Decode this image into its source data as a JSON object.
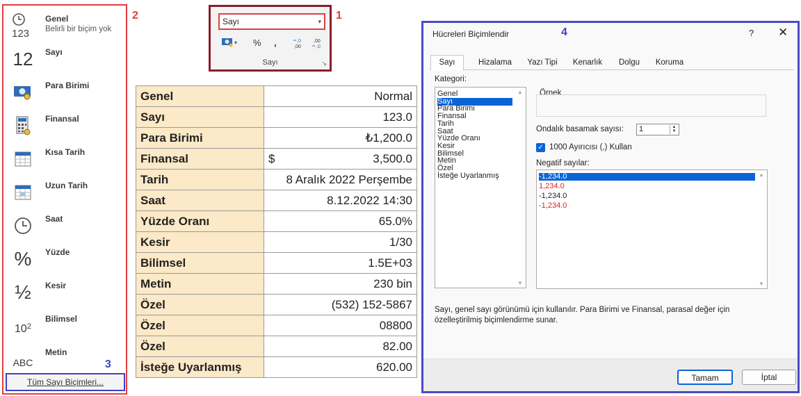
{
  "gallery": {
    "items": [
      {
        "icon": "clock-123-icon",
        "label": "Genel",
        "sub": "Belirli bir biçim yok"
      },
      {
        "icon": "number-12-icon",
        "label": "Sayı"
      },
      {
        "icon": "money-icon",
        "label": "Para Birimi"
      },
      {
        "icon": "calculator-icon",
        "label": "Finansal"
      },
      {
        "icon": "calendar-short-icon",
        "label": "Kısa Tarih"
      },
      {
        "icon": "calendar-long-icon",
        "label": "Uzun Tarih"
      },
      {
        "icon": "clock-icon",
        "label": "Saat"
      },
      {
        "icon": "percent-icon",
        "label": "Yüzde"
      },
      {
        "icon": "fraction-icon",
        "label": "Kesir"
      },
      {
        "icon": "scientific-icon",
        "label": "Bilimsel"
      },
      {
        "icon": "abc-icon",
        "label": "Metin"
      }
    ],
    "icon_glyphs": {
      "number12": "12",
      "percent": "%",
      "fraction": "½",
      "sci_base": "10",
      "sci_exp": "2",
      "abc": "ABC",
      "c123": "123"
    },
    "more_label": "Tüm Sayı Biçimleri..."
  },
  "markers": {
    "one": "1",
    "two": "2",
    "three": "3",
    "four": "4"
  },
  "ribbon": {
    "dropdown_value": "Sayı",
    "buttons": {
      "percent": "%",
      "comma": ",",
      "inc": "+.0\n.00",
      "dec": ".00\n→.0"
    },
    "group_label": "Sayı"
  },
  "examples": [
    {
      "label": "Genel",
      "value": "Normal"
    },
    {
      "label": "Sayı",
      "value": "123.0"
    },
    {
      "label": "Para Birimi",
      "value": "₺1,200.0"
    },
    {
      "label": "Finansal",
      "symbol": "$",
      "value": "3,500.0"
    },
    {
      "label": "Tarih",
      "value": "8 Aralık 2022 Perşembe"
    },
    {
      "label": "Saat",
      "value": "8.12.2022 14:30"
    },
    {
      "label": "Yüzde Oranı",
      "value": "65.0%"
    },
    {
      "label": "Kesir",
      "value": "1/30"
    },
    {
      "label": "Bilimsel",
      "value": "1.5E+03"
    },
    {
      "label": "Metin",
      "value": "230 bin"
    },
    {
      "label": "Özel",
      "value": "(532) 152-5867"
    },
    {
      "label": "Özel",
      "value": "08800"
    },
    {
      "label": "Özel",
      "value": "82.00"
    },
    {
      "label": "İsteğe Uyarlanmış",
      "value": "620.00"
    }
  ],
  "dialog": {
    "title": "Hücreleri Biçimlendir",
    "help": "?",
    "close": "✕",
    "tabs": [
      "Sayı",
      "Hizalama",
      "Yazı Tipi",
      "Kenarlık",
      "Dolgu",
      "Koruma"
    ],
    "category_label": "Kategori:",
    "categories": [
      "Genel",
      "Sayı",
      "Para Birimi",
      "Finansal",
      "Tarih",
      "Saat",
      "Yüzde Oranı",
      "Kesir",
      "Bilimsel",
      "Metin",
      "Özel",
      "İsteğe Uyarlanmış"
    ],
    "selected_category": "Sayı",
    "sample_label": "Örnek",
    "decimal_label": "Ondalık basamak sayısı:",
    "decimal_value": "1",
    "separator_checked": true,
    "separator_label": "1000 Ayırıcısı (,) Kullan",
    "negative_label": "Negatif sayılar:",
    "negatives": [
      {
        "text": "-1,234.0",
        "color": "#ffffff"
      },
      {
        "text": "1,234.0",
        "color": "#e02020"
      },
      {
        "text": "-1,234.0",
        "color": "#222222"
      },
      {
        "text": "-1,234.0",
        "color": "#e02020"
      }
    ],
    "description": "Sayı, genel sayı görünümü için kullanılır. Para Birimi ve Finansal, parasal değer için özelleştirilmiş biçimlendirme sunar.",
    "ok": "Tamam",
    "cancel": "İptal"
  },
  "colors": {
    "red_marker": "#e23d3d",
    "blue_marker": "#4040c8",
    "ribbon_border": "#8b1d2a",
    "label_fill": "#fbe9c7",
    "selection": "#0a64d6"
  }
}
